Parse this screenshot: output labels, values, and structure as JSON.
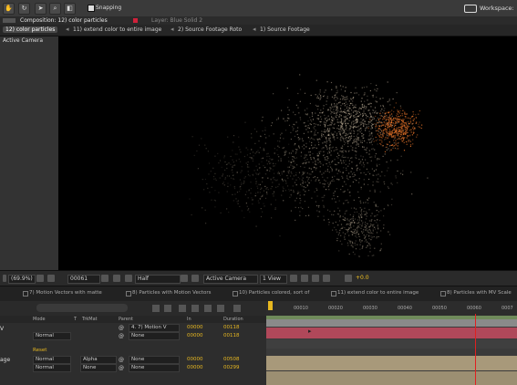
{
  "toolbar": {
    "tools": [
      "hand-tool",
      "rotate-tool",
      "selection-tool",
      "zoom-tool",
      "camera-tool"
    ],
    "snapping_label": "Snapping",
    "workspace_label": "Workspace:"
  },
  "panels": {
    "composition_title": "Composition: 12) color particles",
    "layer_title": "Layer: Blue Solid 2"
  },
  "breadcrumbs": [
    "12) color particles",
    "11) extend color to entire image",
    "2) Source Footage Roto",
    "1) Source Footage"
  ],
  "viewer": {
    "camera_label": "Active Camera",
    "zoom": "(69.9%)",
    "timecode": "00061",
    "resolution": "Half",
    "view": "Active Camera",
    "views_count": "1 View",
    "exposure": "+0.0",
    "colors": {
      "particle_warm": "#e07028",
      "particle_light": "#c8b8a0"
    }
  },
  "timeline_tabs": [
    "7) Motion Vectors with matte",
    "8) Particles with Motion Vectors",
    "10) Particles colored, sort of",
    "11) extend color to entire image",
    "8) Particles with MV Scale"
  ],
  "layer_columns": {
    "mode": "Mode",
    "t": "T",
    "trkmat": "TrkMat",
    "parent": "Parent",
    "in": "In",
    "duration": "Duration"
  },
  "layers": [
    {
      "name": "V",
      "parent": "4. 7) Motion V",
      "in": "00000",
      "duration": "00118"
    },
    {
      "name": "",
      "mode": "Normal",
      "parent": "None",
      "in": "00000",
      "duration": "00118"
    },
    {
      "reset": "Reset"
    },
    {
      "name": "age",
      "mode": "Normal",
      "trkmat": "Alpha",
      "parent": "None",
      "in": "00000",
      "duration": "00508"
    },
    {
      "name": "",
      "mode": "Normal",
      "trkmat": "None",
      "parent": "None",
      "in": "00000",
      "duration": "00299"
    }
  ],
  "ruler_ticks": [
    "00010",
    "00020",
    "00030",
    "00040",
    "00050",
    "00060",
    "0007"
  ],
  "track_colors": {
    "red": "#b0485a",
    "tan": "#a8997a",
    "green": "#6f8a5a"
  }
}
